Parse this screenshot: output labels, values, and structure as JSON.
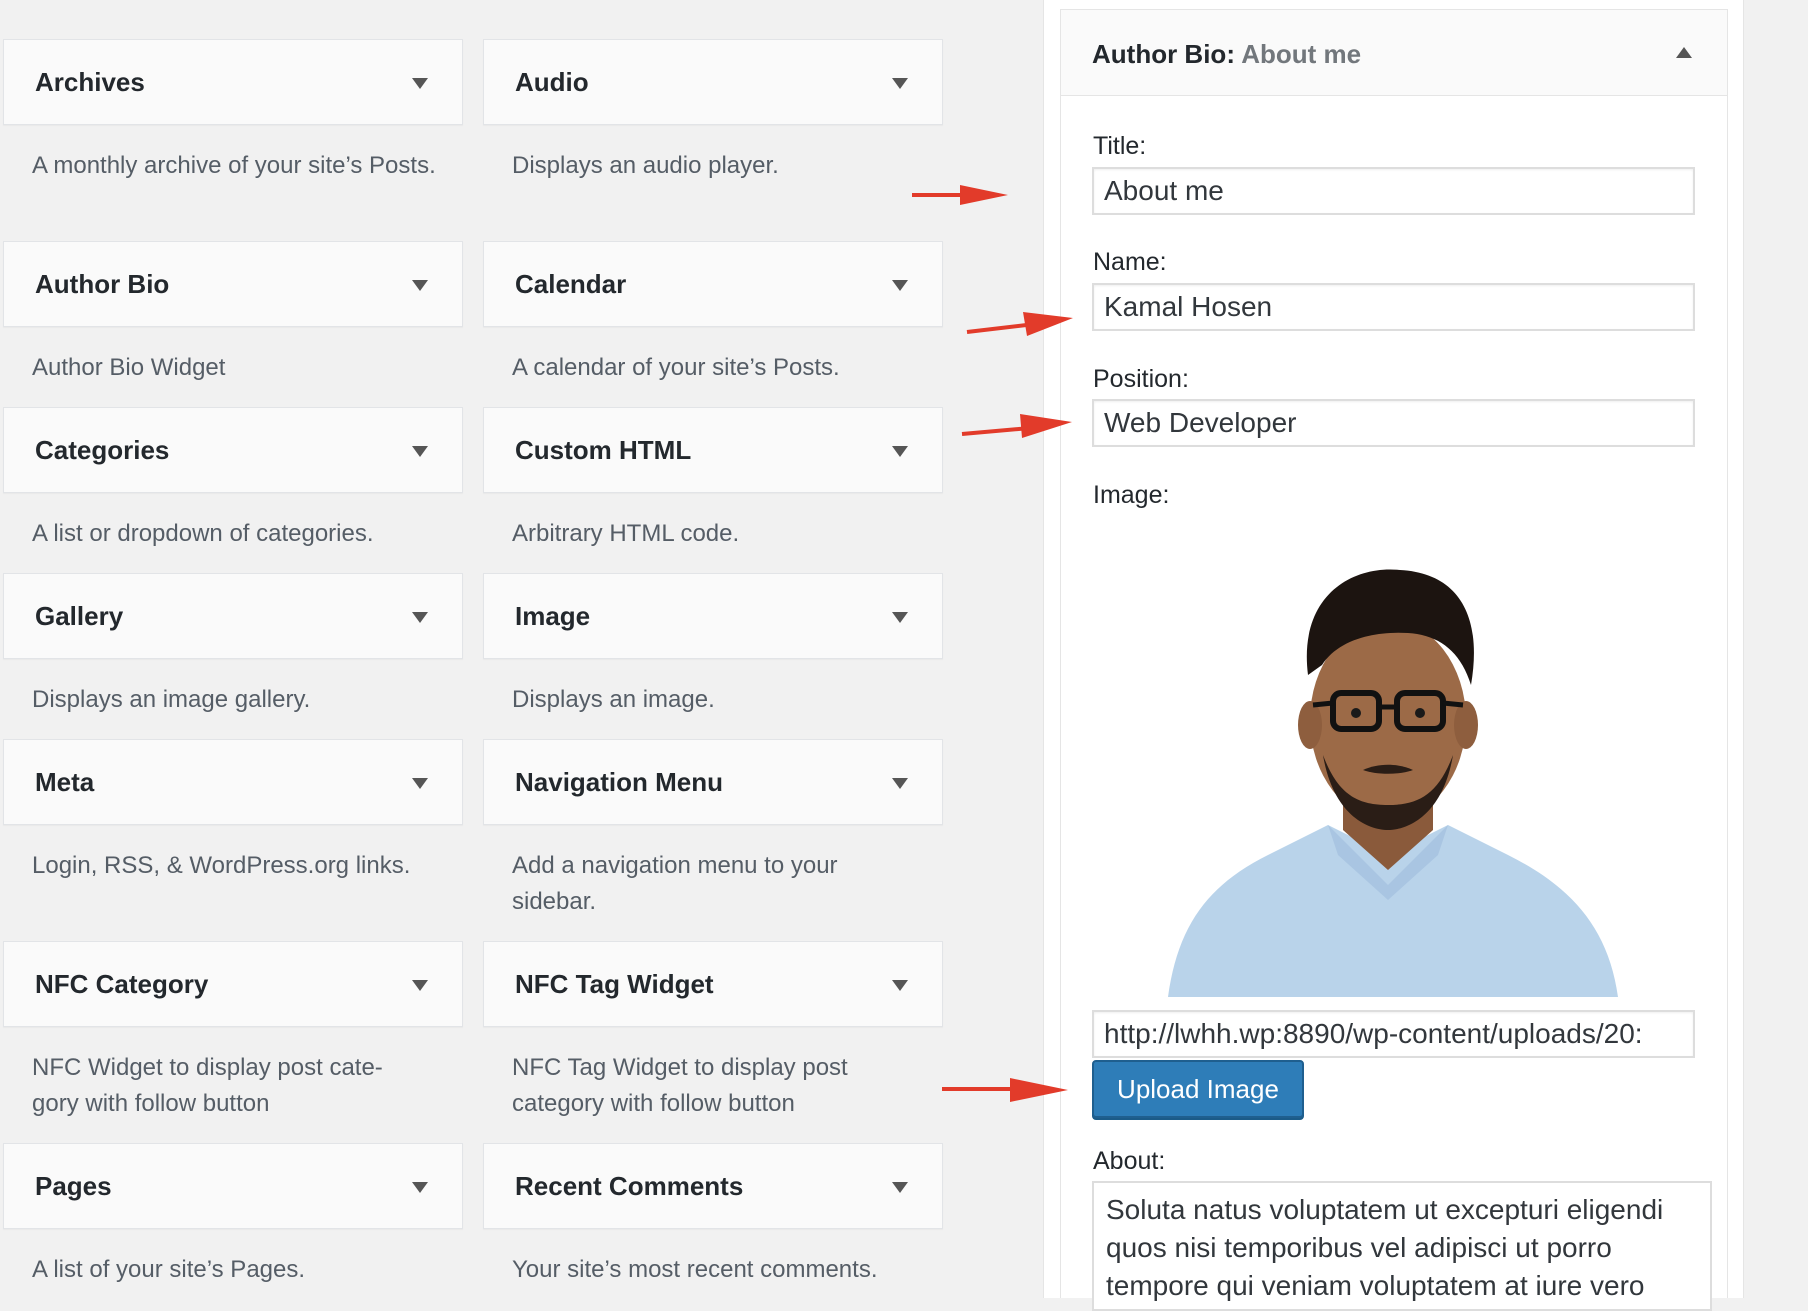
{
  "available_widgets": [
    {
      "title": "Archives",
      "description": "A monthly archive of your site’s Posts."
    },
    {
      "title": "Audio",
      "description": "Displays an audio player."
    },
    {
      "title": "Author Bio",
      "description": "Author Bio Widget"
    },
    {
      "title": "Calendar",
      "description": "A calendar of your site’s Posts."
    },
    {
      "title": "Categories",
      "description": "A list or dropdown of categories."
    },
    {
      "title": "Custom HTML",
      "description": "Arbitrary HTML code."
    },
    {
      "title": "Gallery",
      "description": "Displays an image gallery."
    },
    {
      "title": "Image",
      "description": "Displays an image."
    },
    {
      "title": "Meta",
      "description": "Login, RSS, & WordPress.org links."
    },
    {
      "title": "Navigation Menu",
      "description": "Add a navigation menu to your sidebar."
    },
    {
      "title": "NFC Category",
      "description": "NFC Widget to display post cate- gory with follow button"
    },
    {
      "title": "NFC Tag Widget",
      "description": "NFC Tag Widget to display post category with follow button"
    },
    {
      "title": "Pages",
      "description": "A list of your site’s Pages."
    },
    {
      "title": "Recent Comments",
      "description": "Your site’s most recent comments."
    }
  ],
  "panel": {
    "widget_name": "Author Bio",
    "separator": ":",
    "instance_title": " About me",
    "collapse_icon": "arrow-up-icon",
    "fields": {
      "title_label": "Title:",
      "title_value": "About me",
      "name_label": "Name:",
      "name_value": "Kamal Hosen",
      "position_label": "Position:",
      "position_value": "Web Developer",
      "image_label": "Image:",
      "image_url_value": "http://lwhh.wp:8890/wp-content/uploads/20:",
      "upload_button": "Upload Image",
      "about_label": "About:",
      "about_value": "Soluta natus voluptatem ut excepturi eligendi quos nisi temporibus vel adipisci ut porro tempore qui veniam voluptatem at iure vero"
    }
  },
  "colors": {
    "annotation_arrow": "#e23b2a",
    "button_primary": "#2e7db8"
  }
}
